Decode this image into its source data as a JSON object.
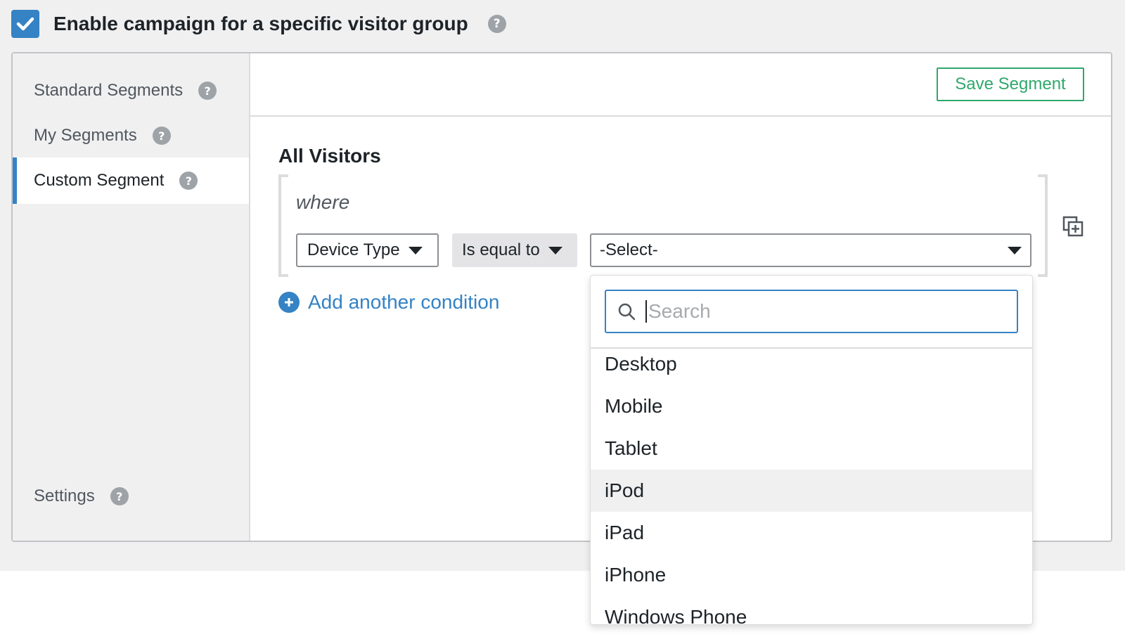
{
  "enable": {
    "checked": true,
    "label": "Enable campaign for a specific visitor group",
    "help_icon": "question-circle-icon"
  },
  "sidebar": {
    "items": [
      {
        "label": "Standard Segments",
        "active": false
      },
      {
        "label": "My Segments",
        "active": false
      },
      {
        "label": "Custom Segment",
        "active": true
      }
    ],
    "settings_label": "Settings"
  },
  "header": {
    "save_label": "Save Segment"
  },
  "segment": {
    "title": "All Visitors",
    "where_label": "where",
    "condition": {
      "field": "Device Type",
      "operator": "Is equal to",
      "value": "-Select-"
    },
    "add_condition_label": "Add another condition",
    "duplicate_icon": "duplicate-plus-icon"
  },
  "dropdown": {
    "search_placeholder": "Search",
    "options": [
      "Desktop",
      "Mobile",
      "Tablet",
      "iPod",
      "iPad",
      "iPhone",
      "Windows Phone"
    ],
    "highlighted": "iPod"
  },
  "colors": {
    "accent": "#3582c4",
    "save_green": "#2fa86c",
    "background": "#f0f0f1"
  }
}
